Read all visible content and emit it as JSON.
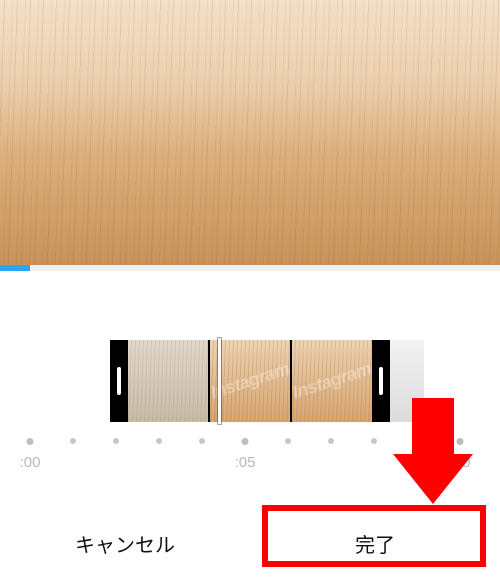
{
  "preview": {
    "progress_percent": 6
  },
  "trimmer": {
    "watermark": "Instagram",
    "playhead_percent": 36
  },
  "scale": {
    "ticks": [
      {
        "pos": 30,
        "major": true,
        "label": ":00"
      },
      {
        "pos": 73,
        "major": false,
        "label": ""
      },
      {
        "pos": 116,
        "major": false,
        "label": ""
      },
      {
        "pos": 159,
        "major": false,
        "label": ""
      },
      {
        "pos": 202,
        "major": false,
        "label": ""
      },
      {
        "pos": 245,
        "major": true,
        "label": ":05"
      },
      {
        "pos": 288,
        "major": false,
        "label": ""
      },
      {
        "pos": 331,
        "major": false,
        "label": ""
      },
      {
        "pos": 374,
        "major": false,
        "label": ""
      },
      {
        "pos": 417,
        "major": false,
        "label": ""
      },
      {
        "pos": 460,
        "major": true,
        "label": ":10"
      }
    ]
  },
  "buttons": {
    "cancel_label": "キャンセル",
    "done_label": "完了"
  },
  "annotation": {
    "arrow_color": "#ff0000",
    "box_color": "#ff0000"
  }
}
